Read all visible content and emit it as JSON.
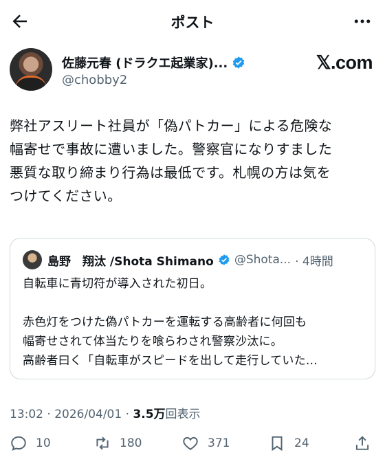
{
  "header": {
    "title": "ポスト",
    "back_icon": "back-arrow-icon",
    "more_icon": "more-horizontal-icon"
  },
  "author": {
    "display_name": "佐藤元春 (ドラクエ起業家)...",
    "handle": "@chobby2",
    "verified": true,
    "source_label": "𝕏.com"
  },
  "post": {
    "lines": [
      "弊社アスリート社員が「偽パトカー」による危険な",
      "幅寄せで事故に遭いました。警察官になりすました",
      "悪質な取り締まり行為は最低です。札幌の方は気を",
      "つけてください。"
    ]
  },
  "quoted": {
    "display_name": "島野　翔汰 /Shota Shimano",
    "handle": "@Shota...",
    "time": "· 4時間",
    "lines": [
      "自転車に青切符が導入された初日。",
      "",
      "赤色灯をつけた偽パトカーを運転する高齢者に何回も",
      "幅寄せされて体当たりを喰らわされ警察沙汰に。",
      "高齢者曰く「自転車がスピードを出して走行していた…"
    ]
  },
  "meta": {
    "time": "13:02 · 2026/04/01 · ",
    "views_count": "3.5万",
    "views_label": "回表示"
  },
  "actions": {
    "replies": "10",
    "reposts": "180",
    "likes": "371",
    "bookmarks": "24"
  },
  "colors": {
    "verified_blue": "#1d9bf0",
    "secondary_text": "#536471",
    "border": "#cfd9de"
  }
}
